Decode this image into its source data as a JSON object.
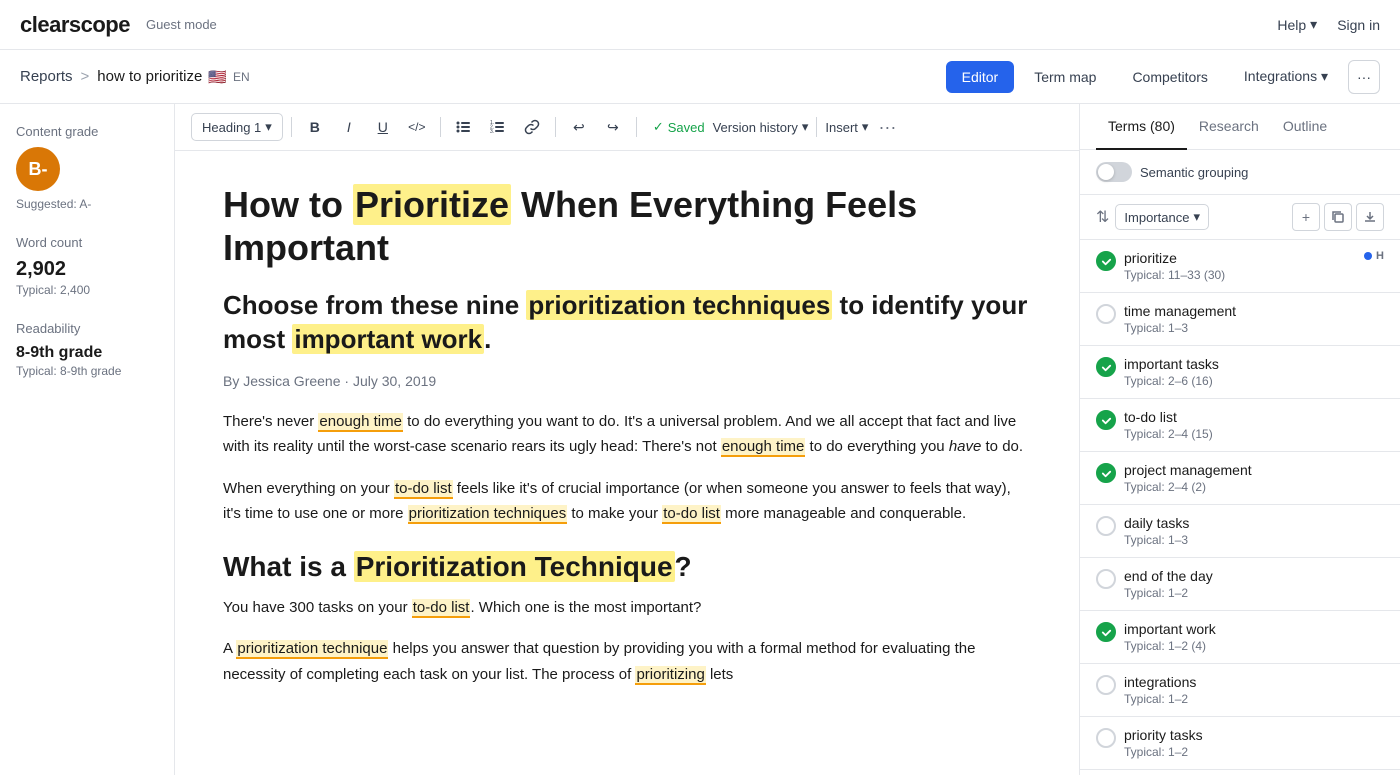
{
  "app": {
    "logo": "clearscope",
    "guest_mode": "Guest mode",
    "help": "Help",
    "sign_in": "Sign in"
  },
  "breadcrumb": {
    "reports": "Reports",
    "separator": ">",
    "current": "how to prioritize",
    "flag": "🇺🇸",
    "lang": "EN"
  },
  "nav_tabs": [
    {
      "label": "Editor",
      "active": true
    },
    {
      "label": "Term map",
      "active": false
    },
    {
      "label": "Competitors",
      "active": false
    },
    {
      "label": "Integrations",
      "active": false
    }
  ],
  "sidebar": {
    "content_grade_label": "Content grade",
    "grade": "B-",
    "suggested_label": "Suggested: A-",
    "word_count_label": "Word count",
    "word_count_value": "2,902",
    "word_count_typical": "Typical: 2,400",
    "readability_label": "Readability",
    "readability_value": "8-9th grade",
    "readability_typical": "Typical: 8-9th grade"
  },
  "toolbar": {
    "heading_select": "Heading 1",
    "bold": "B",
    "italic": "I",
    "underline": "U",
    "code": "</>",
    "bullet_list": "•≡",
    "numbered_list": "1≡",
    "link": "🔗",
    "undo": "↩",
    "redo": "↪",
    "saved": "Saved",
    "version_history": "Version history",
    "insert": "Insert",
    "more": "···"
  },
  "article": {
    "title_plain": "How to Prioritize When Everything Feels Important",
    "subtitle": "Choose from these nine prioritization techniques to identify your most important work.",
    "byline": "By Jessica Greene · July 30, 2019",
    "para1": "There's never enough time to do everything you want to do. It's a universal problem. And we all accept that fact and live with its reality until the worst-case scenario rears its ugly head: There's not enough time to do everything you have to do.",
    "para2": "When everything on your to-do list feels like it's of crucial importance (or when someone you answer to feels that way), it's time to use one or more prioritization techniques to make your to-do list more manageable and conquerable.",
    "h2": "What is a Prioritization Technique?",
    "para3": "You have 300 tasks on your to-do list. Which one is the most important?",
    "para4": "A prioritization technique helps you answer that question by providing you with a formal method for evaluating the necessity of completing each task on your list. The process of prioritizing lets"
  },
  "right_panel": {
    "tabs": [
      {
        "label": "Terms (80)",
        "active": true
      },
      {
        "label": "Research",
        "active": false
      },
      {
        "label": "Outline",
        "active": false
      }
    ],
    "semantic_grouping": "Semantic grouping",
    "sort_label": "Importance",
    "terms": [
      {
        "name": "prioritize",
        "typical": "Typical: 11–33 (30)",
        "checked": true,
        "badge_dot": true,
        "badge_h": "H"
      },
      {
        "name": "time management",
        "typical": "Typical: 1–3",
        "checked": false,
        "badge_dot": false,
        "badge_h": ""
      },
      {
        "name": "important tasks",
        "typical": "Typical: 2–6 (16)",
        "checked": true,
        "badge_dot": false,
        "badge_h": ""
      },
      {
        "name": "to-do list",
        "typical": "Typical: 2–4 (15)",
        "checked": true,
        "badge_dot": false,
        "badge_h": ""
      },
      {
        "name": "project management",
        "typical": "Typical: 2–4 (2)",
        "checked": true,
        "badge_dot": false,
        "badge_h": ""
      },
      {
        "name": "daily tasks",
        "typical": "Typical: 1–3",
        "checked": false,
        "badge_dot": false,
        "badge_h": ""
      },
      {
        "name": "end of the day",
        "typical": "Typical: 1–2",
        "checked": false,
        "badge_dot": false,
        "badge_h": ""
      },
      {
        "name": "important work",
        "typical": "Typical: 1–2 (4)",
        "checked": true,
        "badge_dot": false,
        "badge_h": ""
      },
      {
        "name": "integrations",
        "typical": "Typical: 1–2",
        "checked": false,
        "badge_dot": false,
        "badge_h": ""
      },
      {
        "name": "priority tasks",
        "typical": "Typical: 1–2",
        "checked": false,
        "badge_dot": false,
        "badge_h": ""
      }
    ]
  }
}
